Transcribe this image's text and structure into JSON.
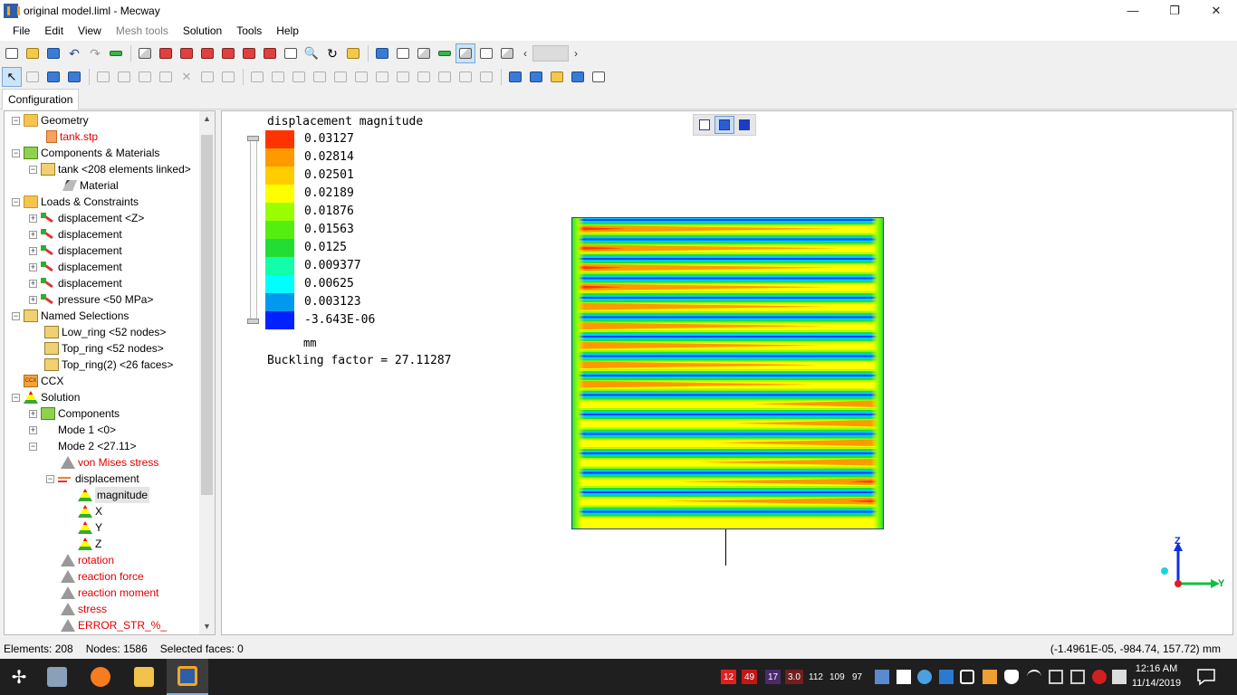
{
  "window": {
    "title": "original model.liml - Mecway",
    "buttons": [
      "—",
      "❐",
      "✕"
    ]
  },
  "menu": [
    {
      "label": "File",
      "enabled": true
    },
    {
      "label": "Edit",
      "enabled": true
    },
    {
      "label": "View",
      "enabled": true
    },
    {
      "label": "Mesh tools",
      "enabled": false
    },
    {
      "label": "Solution",
      "enabled": true
    },
    {
      "label": "Tools",
      "enabled": true
    },
    {
      "label": "Help",
      "enabled": true
    }
  ],
  "tab": {
    "label": "Configuration"
  },
  "tree": {
    "geometry": "Geometry",
    "geometry_file": "tank.stp",
    "components": "Components & Materials",
    "tank": "tank <208 elements linked>",
    "material": "Material",
    "loads": "Loads & Constraints",
    "load_items": [
      "displacement <Z>",
      "displacement",
      "displacement",
      "displacement",
      "displacement",
      "pressure <50 MPa>"
    ],
    "named_selections": "Named Selections",
    "selections": [
      "Low_ring <52 nodes>",
      "Top_ring <52 nodes>",
      "Top_ring(2) <26 faces>"
    ],
    "ccx": "CCX",
    "solution": "Solution",
    "sol_components": "Components",
    "mode1": "Mode 1 <0>",
    "mode2": "Mode 2 <27.11>",
    "von_mises": "von Mises stress",
    "displacement": "displacement",
    "disp_children": [
      "magnitude",
      "X",
      "Y",
      "Z"
    ],
    "rotation": "rotation",
    "reaction_force": "reaction force",
    "reaction_moment": "reaction moment",
    "stress": "stress",
    "error": "ERROR_STR_%_"
  },
  "legend": {
    "title": "displacement magnitude",
    "values": [
      "0.03127",
      "0.02814",
      "0.02501",
      "0.02189",
      "0.01876",
      "0.01563",
      "0.0125",
      "0.009377",
      "0.00625",
      "0.003123",
      "-3.643E-06"
    ],
    "colors": [
      "#ff3300",
      "#ff9900",
      "#ffcc00",
      "#ffff00",
      "#99ff00",
      "#55ee11",
      "#22dd33",
      "#11ffaa",
      "#00ffff",
      "#0099ee",
      "#0022ff"
    ],
    "unit": "mm",
    "buckling": "Buckling factor = 27.11287"
  },
  "triad": {
    "z": "Z",
    "y": "Y"
  },
  "status": {
    "elements": "Elements: 208",
    "nodes": "Nodes: 1586",
    "faces": "Selected faces: 0",
    "coords": "(-1.4961E-05, -984.74, 157.72) mm"
  },
  "taskbar": {
    "badges": [
      "12",
      "49",
      "17",
      "3.0",
      "112",
      "109",
      "97"
    ],
    "time": "12:16 AM",
    "date": "11/14/2019"
  }
}
